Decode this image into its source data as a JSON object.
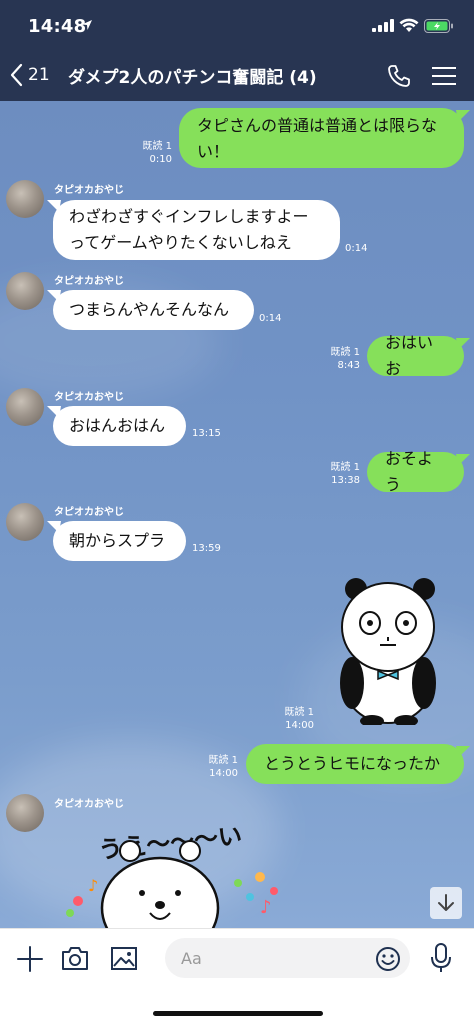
{
  "status_bar": {
    "time": "14:48"
  },
  "nav": {
    "back_count": "21",
    "title": "ダメプ2人のパチンコ奮闘記 (4)"
  },
  "messages": {
    "out1": {
      "line1": "タピさんの普通は普通とは限らな",
      "line2": "い！",
      "read": "既読 1",
      "time": "0:10"
    },
    "in1": {
      "sender": "タピオカおやじ",
      "line1": "わざわざすぐインフレしますよー",
      "line2": "ってゲームやりたくないしねえ",
      "time": "0:14"
    },
    "in2": {
      "sender": "タピオカおやじ",
      "text": "つまらんやんそんなん",
      "time": "0:14"
    },
    "out2": {
      "text": "おはいお",
      "read": "既読 1",
      "time": "8:43"
    },
    "in3": {
      "sender": "タピオカおやじ",
      "text": "おはんおはん",
      "time": "13:15"
    },
    "out3": {
      "text": "おそよう",
      "read": "既読 1",
      "time": "13:38"
    },
    "in4": {
      "sender": "タピオカおやじ",
      "text": "朝からスプラ",
      "time": "13:59"
    },
    "sticker_out": {
      "read": "既読 1",
      "time": "14:00"
    },
    "out4": {
      "text": "とうとうヒモになったか",
      "read": "既読 1",
      "time": "14:00"
    },
    "in5": {
      "sender": "タピオカおやじ",
      "sticker_text": "うえ〜〜〜い"
    }
  },
  "input": {
    "placeholder": "Aa"
  },
  "icons": {
    "plus": "plus-icon",
    "camera": "camera-icon",
    "image": "image-icon",
    "emoji": "emoji-icon",
    "mic": "microphone-icon",
    "scroll_down": "arrow-down-icon",
    "phone": "phone-icon",
    "menu": "menu-icon",
    "back": "chevron-left-icon"
  },
  "colors": {
    "header": "#283552",
    "bubble_out": "#86e05a",
    "bubble_in": "#ffffff",
    "chat_bg": "#7193c6"
  }
}
